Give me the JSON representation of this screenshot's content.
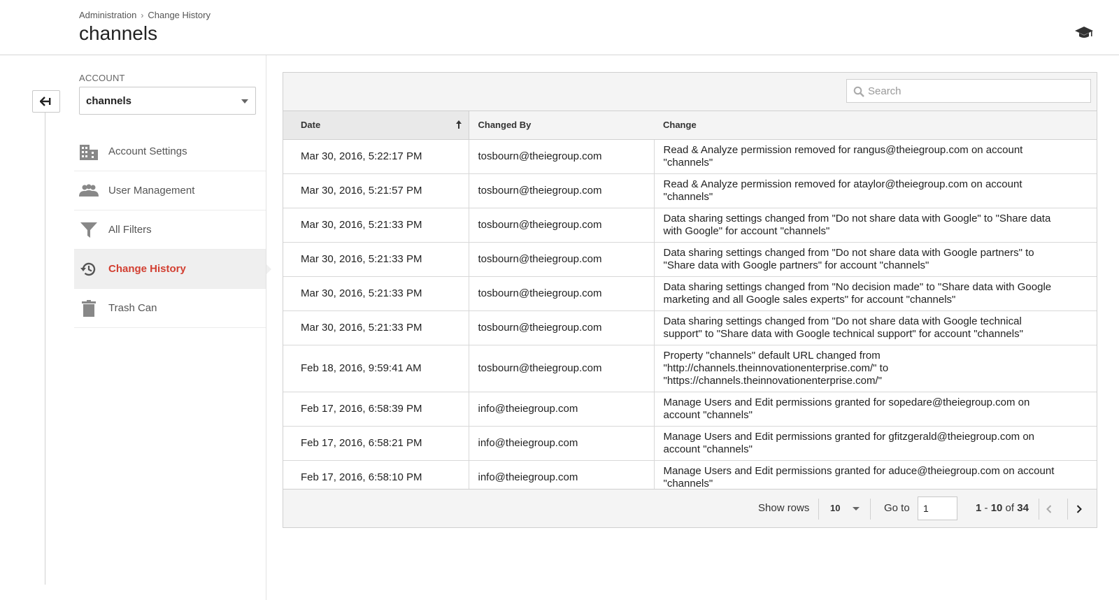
{
  "header": {
    "breadcrumb": [
      "Administration",
      "Change History"
    ],
    "breadcrumb_sep": "›",
    "title": "channels",
    "right_icon": "graduation-cap-icon"
  },
  "sidebar": {
    "account_label": "ACCOUNT",
    "account_value": "channels",
    "items": [
      {
        "label": "Account Settings",
        "icon": "building-icon",
        "active": false
      },
      {
        "label": "User Management",
        "icon": "users-icon",
        "active": false
      },
      {
        "label": "All Filters",
        "icon": "filter-icon",
        "active": false
      },
      {
        "label": "Change History",
        "icon": "history-icon",
        "active": true
      },
      {
        "label": "Trash Can",
        "icon": "trash-icon",
        "active": false
      }
    ]
  },
  "search": {
    "placeholder": "Search"
  },
  "table": {
    "columns": [
      "Date",
      "Changed By",
      "Change"
    ],
    "rows": [
      {
        "date": "Mar 30, 2016, 5:22:17 PM",
        "by": "tosbourn@theiegroup.com",
        "change": [
          "Read & Analyze permission removed for rangus@theiegroup.com on account",
          "\"channels\""
        ]
      },
      {
        "date": "Mar 30, 2016, 5:21:57 PM",
        "by": "tosbourn@theiegroup.com",
        "change": [
          "Read & Analyze permission removed for ataylor@theiegroup.com on account",
          "\"channels\""
        ]
      },
      {
        "date": "Mar 30, 2016, 5:21:33 PM",
        "by": "tosbourn@theiegroup.com",
        "change": [
          "Data sharing settings changed from \"Do not share data with Google\" to \"Share data",
          "with Google\" for account \"channels\""
        ]
      },
      {
        "date": "Mar 30, 2016, 5:21:33 PM",
        "by": "tosbourn@theiegroup.com",
        "change": [
          "Data sharing settings changed from \"Do not share data with Google partners\" to",
          "\"Share data with Google partners\" for account \"channels\""
        ]
      },
      {
        "date": "Mar 30, 2016, 5:21:33 PM",
        "by": "tosbourn@theiegroup.com",
        "change": [
          "Data sharing settings changed from \"No decision made\" to \"Share data with Google",
          "marketing and all Google sales experts\" for account \"channels\""
        ]
      },
      {
        "date": "Mar 30, 2016, 5:21:33 PM",
        "by": "tosbourn@theiegroup.com",
        "change": [
          "Data sharing settings changed from \"Do not share data with Google technical",
          "support\" to \"Share data with Google technical support\" for account \"channels\""
        ]
      },
      {
        "date": "Feb 18, 2016, 9:59:41 AM",
        "by": "tosbourn@theiegroup.com",
        "change": [
          "Property \"channels\" default URL changed from",
          "\"http://channels.theinnovationenterprise.com/\" to",
          "\"https://channels.theinnovationenterprise.com/\""
        ]
      },
      {
        "date": "Feb 17, 2016, 6:58:39 PM",
        "by": "info@theiegroup.com",
        "change": [
          "Manage Users and Edit permissions granted for sopedare@theiegroup.com on",
          "account \"channels\""
        ]
      },
      {
        "date": "Feb 17, 2016, 6:58:21 PM",
        "by": "info@theiegroup.com",
        "change": [
          "Manage Users and Edit permissions granted for gfitzgerald@theiegroup.com on",
          "account \"channels\""
        ]
      },
      {
        "date": "Feb 17, 2016, 6:58:10 PM",
        "by": "info@theiegroup.com",
        "change": [
          "Manage Users and Edit permissions granted for aduce@theiegroup.com on account",
          "\"channels\""
        ]
      }
    ]
  },
  "footer": {
    "show_rows_label": "Show rows",
    "rows_value": "10",
    "goto_label": "Go to",
    "goto_value": "1",
    "range_start": "1",
    "range_dash": " - ",
    "range_end": "10",
    "range_of": " of ",
    "range_total": "34"
  },
  "colors": {
    "accent": "#d23f31",
    "panel_bg": "#f4f4f4"
  }
}
